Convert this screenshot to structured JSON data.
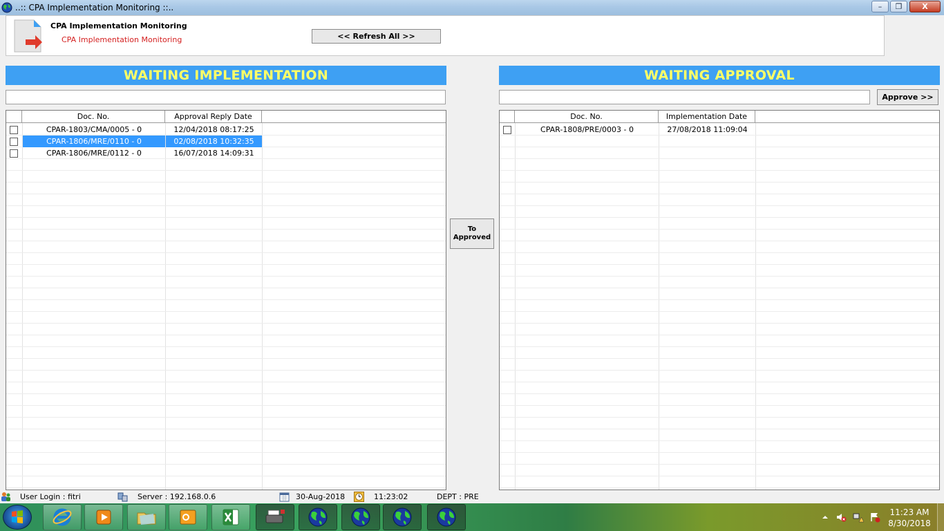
{
  "window": {
    "title": "..:: CPA Implementation Monitoring ::..",
    "minimize_label": "–",
    "maximize_label": "❐",
    "close_label": "X"
  },
  "header": {
    "title": "CPA Implementation Monitoring",
    "subtitle": "CPA Implementation Monitoring",
    "refresh_label": "<< Refresh All >>"
  },
  "left_panel": {
    "heading": "WAITING IMPLEMENTATION",
    "filter_value": "",
    "columns": [
      "Doc. No.",
      "Approval Reply Date"
    ],
    "rows": [
      {
        "doc_no": "CPAR-1803/CMA/0005 - 0",
        "date": "12/04/2018 08:17:25",
        "selected": false
      },
      {
        "doc_no": "CPAR-1806/MRE/0110 - 0",
        "date": "02/08/2018 10:32:35",
        "selected": true
      },
      {
        "doc_no": "CPAR-1806/MRE/0112 - 0",
        "date": "16/07/2018 14:09:31",
        "selected": false
      }
    ]
  },
  "middle": {
    "to_approved_line1": "To",
    "to_approved_line2": "Approved"
  },
  "right_panel": {
    "heading": "WAITING APPROVAL",
    "filter_value": "",
    "approve_label": "Approve >>",
    "columns": [
      "Doc. No.",
      "Implementation Date"
    ],
    "rows": [
      {
        "doc_no": "CPAR-1808/PRE/0003 - 0",
        "date": "27/08/2018 11:09:04",
        "selected": false
      }
    ]
  },
  "statusbar": {
    "user": "User Login : fitri",
    "server": "Server : 192.168.0.6",
    "date": "30-Aug-2018",
    "time": "11:23:02",
    "dept": "DEPT : PRE"
  },
  "taskbar": {
    "clock_time": "11:23 AM",
    "clock_date": "8/30/2018",
    "apps": [
      "internet-explorer",
      "media-player",
      "windows-explorer",
      "outlook",
      "excel",
      "printer",
      "cpa-app",
      "cpa-app",
      "cpa-app",
      "cpa-app"
    ]
  },
  "colors": {
    "section_header_bg": "#3ea0f3",
    "section_header_text": "#ffff66",
    "selection": "#3399ff",
    "subtitle_red": "#d42020"
  }
}
